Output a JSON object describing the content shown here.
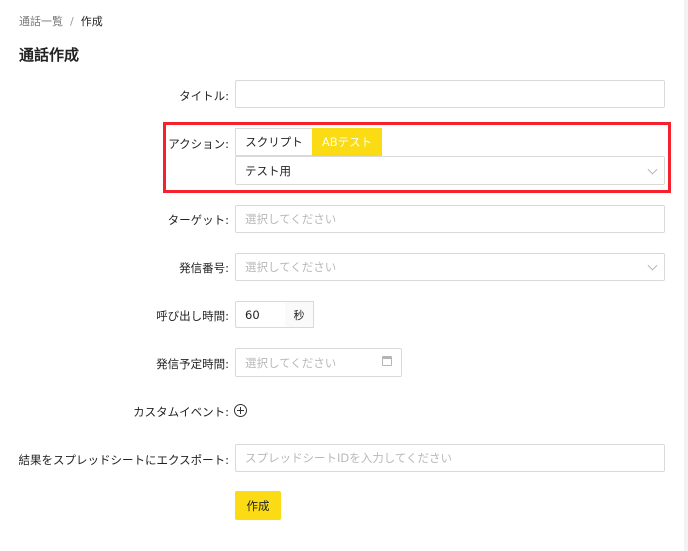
{
  "breadcrumb": {
    "root": "通話一覧",
    "separator": "/",
    "current": "作成"
  },
  "page_title": "通話作成",
  "form": {
    "title": {
      "label": "タイトル:",
      "value": ""
    },
    "action": {
      "label": "アクション:",
      "tabs": [
        "スクリプト",
        "ABテスト"
      ],
      "active_tab": "ABテスト",
      "select_value": "テスト用"
    },
    "target": {
      "label": "ターゲット:",
      "placeholder": "選択してください"
    },
    "caller_number": {
      "label": "発信番号:",
      "placeholder": "選択してください"
    },
    "call_time": {
      "label": "呼び出し時間:",
      "value": "60",
      "unit": "秒"
    },
    "scheduled_time": {
      "label": "発信予定時間:",
      "placeholder": "選択してください"
    },
    "custom_event": {
      "label": "カスタムイベント:"
    },
    "spreadsheet": {
      "label": "結果をスプレッドシートにエクスポート:",
      "placeholder": "スプレッドシートIDを入力してください"
    },
    "submit_label": "作成"
  },
  "colors": {
    "accent": "#fadb14",
    "highlight": "#f5222d"
  }
}
